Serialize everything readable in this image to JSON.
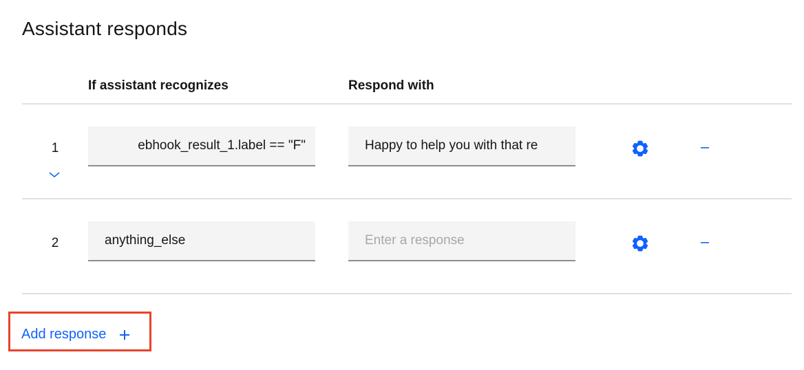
{
  "section": {
    "title": "Assistant responds"
  },
  "table": {
    "headers": {
      "condition": "If assistant recognizes",
      "response": "Respond with"
    },
    "rows": [
      {
        "number": "1",
        "condition": "ebhook_result_1.label == \"F\"",
        "response": "Happy to help you with that re",
        "response_placeholder": "",
        "expanded": false
      },
      {
        "number": "2",
        "condition": "anything_else",
        "response": "",
        "response_placeholder": "Enter a response",
        "expanded": false
      }
    ]
  },
  "actions": {
    "add_response_label": "Add response"
  },
  "icons": {
    "settings": "gear-icon",
    "remove": "minus-icon",
    "expand": "chevron-down-icon",
    "add": "plus-icon"
  },
  "colors": {
    "accent": "#0f62fe",
    "highlight_border": "#e8432d",
    "field_bg": "#f4f4f4",
    "field_border": "#8d8d8d",
    "divider": "#e0e0e0",
    "placeholder": "#a8a8a8"
  }
}
